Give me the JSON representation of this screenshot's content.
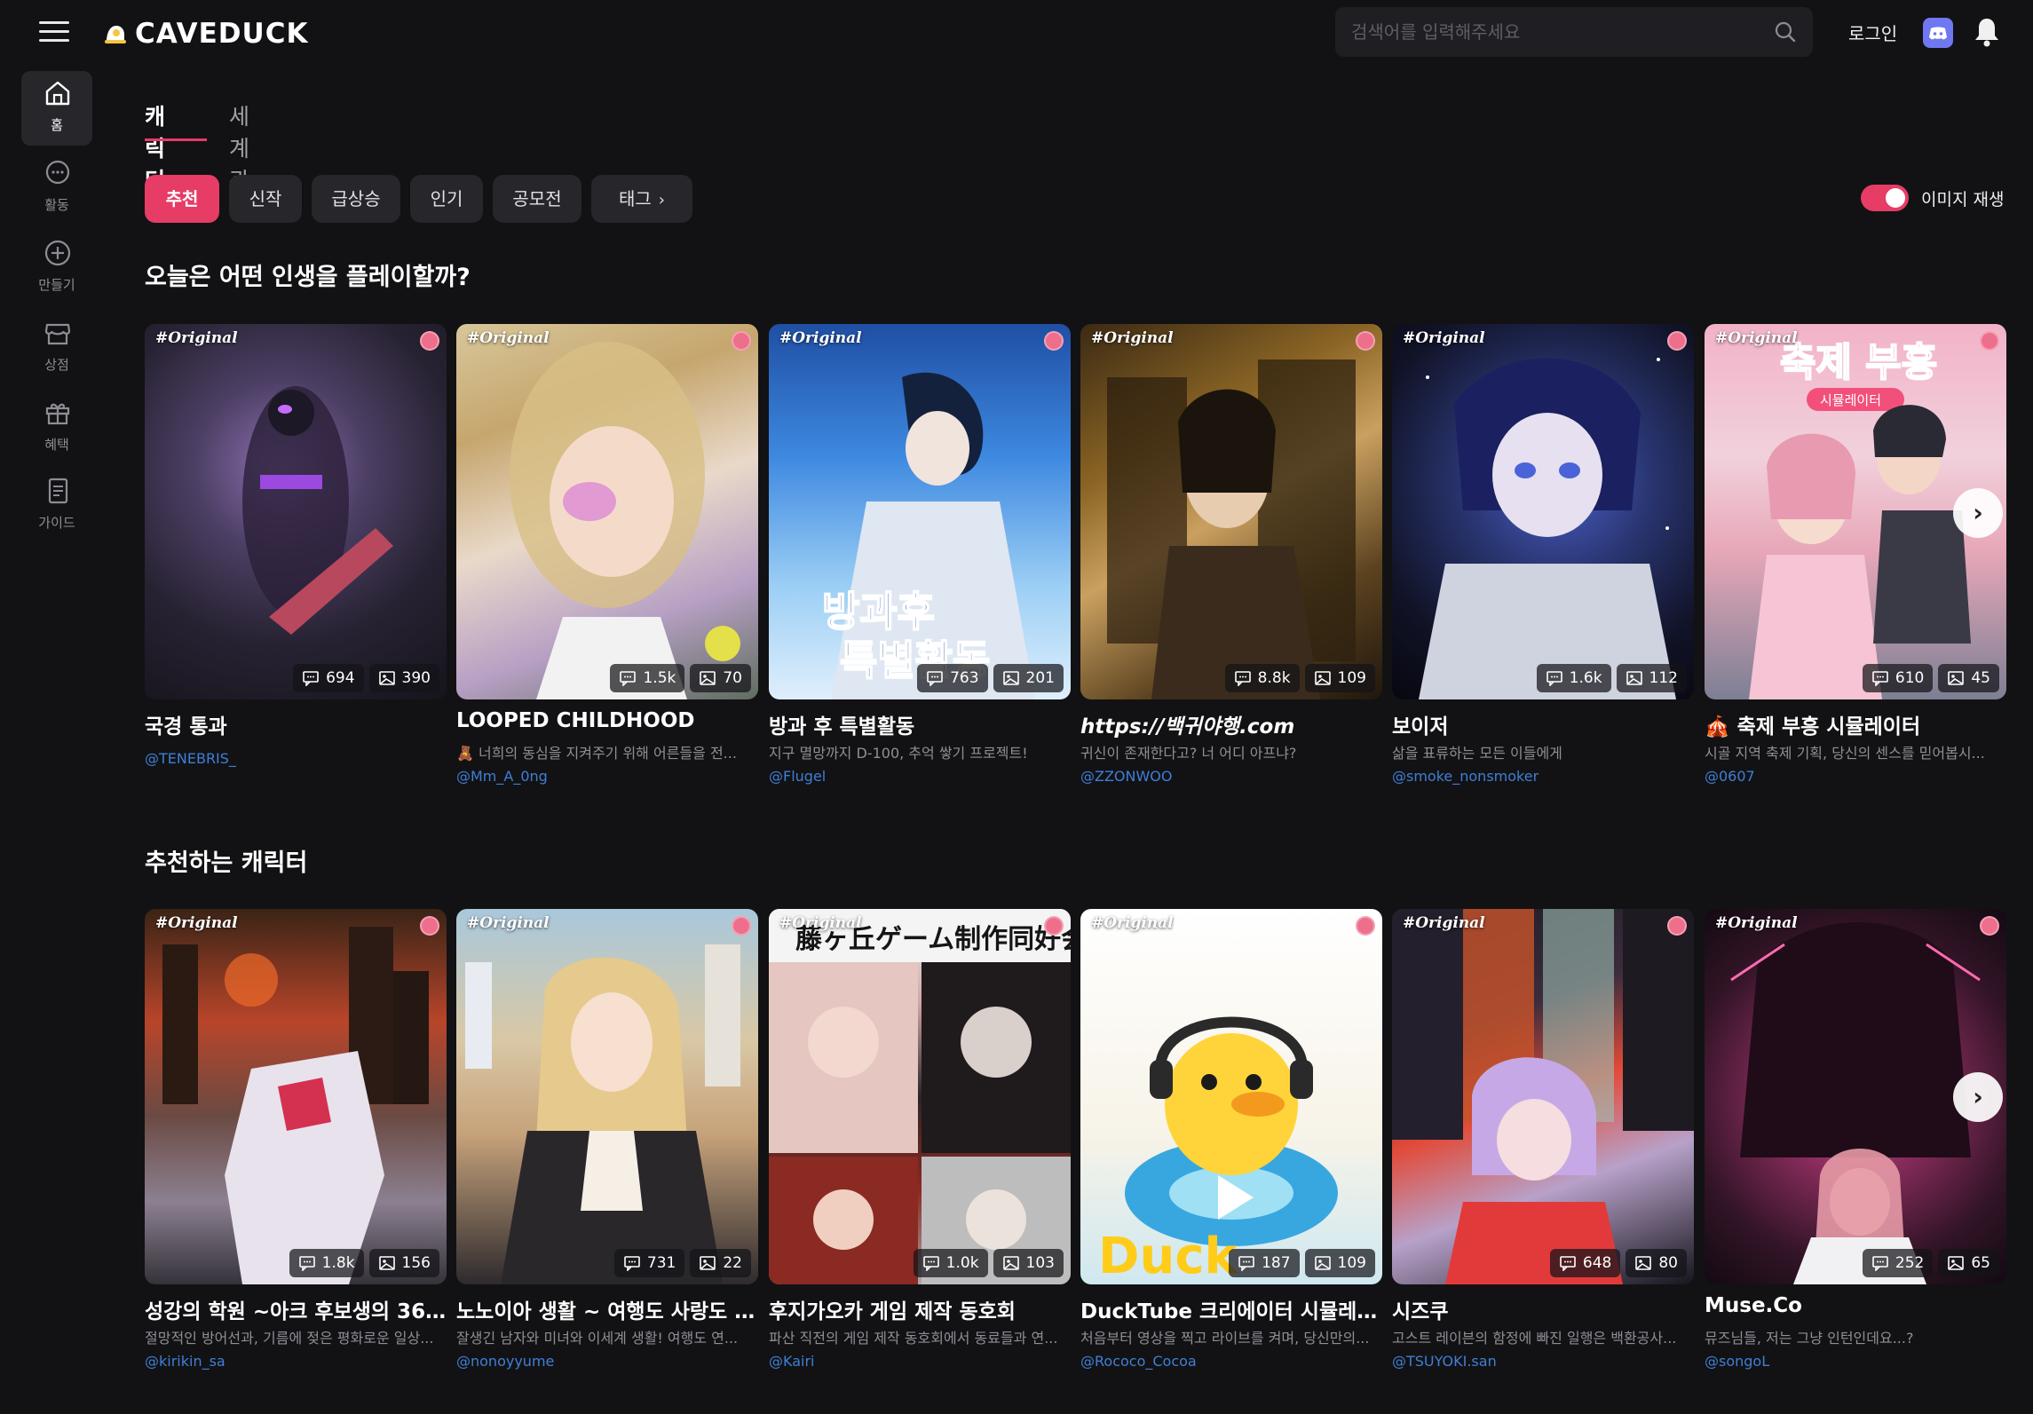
{
  "header": {
    "logo_text": "CAVEDUCK",
    "search_placeholder": "검색어를 입력해주세요",
    "login_label": "로그인"
  },
  "sidebar": {
    "items": [
      {
        "label": "홈",
        "icon": "home-icon",
        "active": true
      },
      {
        "label": "활동",
        "icon": "chat-bubble-icon",
        "active": false
      },
      {
        "label": "만들기",
        "icon": "plus-circle-icon",
        "active": false
      },
      {
        "label": "상점",
        "icon": "store-icon",
        "active": false
      },
      {
        "label": "혜택",
        "icon": "gift-icon",
        "active": false
      },
      {
        "label": "가이드",
        "icon": "document-icon",
        "active": false
      }
    ]
  },
  "tabs": [
    {
      "label": "캐릭터",
      "active": true
    },
    {
      "label": "세계관",
      "active": false
    }
  ],
  "chips": [
    {
      "label": "추천",
      "active": true
    },
    {
      "label": "신작",
      "active": false
    },
    {
      "label": "급상승",
      "active": false
    },
    {
      "label": "인기",
      "active": false
    },
    {
      "label": "공모전",
      "active": false
    },
    {
      "label": "태그",
      "active": false
    }
  ],
  "image_play": {
    "label": "이미지 재생",
    "on": true
  },
  "sections": [
    {
      "title": "오늘은 어떤 인생을 플레이할까?",
      "cards": [
        {
          "tag": "#Original",
          "chats": "694",
          "images": "390",
          "title": "국경 통과",
          "desc": "",
          "author": "@TENEBRIS_"
        },
        {
          "tag": "#Original",
          "chats": "1.5k",
          "images": "70",
          "title": "LOOPED CHILDHOOD",
          "desc": "🧸 너희의 동심을 지켜주기 위해 어른들을 전...",
          "author": "@Mm_A_0ng"
        },
        {
          "tag": "#Original",
          "chats": "763",
          "images": "201",
          "title": "방과 후 특별활동",
          "desc": "지구 멸망까지 D-100, 추억 쌓기 프로젝트!",
          "author": "@Flugel"
        },
        {
          "tag": "#Original",
          "chats": "8.8k",
          "images": "109",
          "title": "https://백귀야행.com",
          "desc": "귀신이 존재한다고? 너 어디 아프냐?",
          "author": "@ZZONWOO"
        },
        {
          "tag": "#Original",
          "chats": "1.6k",
          "images": "112",
          "title": "보이저",
          "desc": "삶을 표류하는 모든 이들에게",
          "author": "@smoke_nonsmoker"
        },
        {
          "tag": "#Original",
          "chats": "610",
          "images": "45",
          "title": "🎪 축제 부흥 시뮬레이터",
          "desc": "시골 지역 축제 기획, 당신의 센스를 믿어봅시...",
          "author": "@0607"
        }
      ]
    },
    {
      "title": "추천하는 캐릭터",
      "cards": [
        {
          "tag": "#Original",
          "chats": "1.8k",
          "images": "156",
          "title": "성강의 학원 ~아크 후보생의 365...",
          "desc": "절망적인 방어선과, 기름에 젖은 평화로운 일상...",
          "author": "@kirikin_sa"
        },
        {
          "tag": "#Original",
          "chats": "731",
          "images": "22",
          "title": "노노이아 생활 ~ 여행도 사랑도 일...",
          "desc": "잘생긴 남자와 미녀와 이세계 생활! 여행도 연...",
          "author": "@nonoyyume"
        },
        {
          "tag": "#Original",
          "chats": "1.0k",
          "images": "103",
          "title": "후지가오카 게임 제작 동호회",
          "desc": "파산 직전의 게임 제작 동호회에서 동료들과 연...",
          "author": "@Kairi"
        },
        {
          "tag": "#Original",
          "chats": "187",
          "images": "109",
          "title": "DuckTube 크리에이터 시뮬레이터",
          "desc": "처음부터 영상을 찍고 라이브를 켜며, 당신만의...",
          "author": "@Rococo_Cocoa"
        },
        {
          "tag": "#Original",
          "chats": "648",
          "images": "80",
          "title": "시즈쿠",
          "desc": "고스트 레이븐의 함정에 빠진 일행은 백환공사...",
          "author": "@TSUYOKI.san"
        },
        {
          "tag": "#Original",
          "chats": "252",
          "images": "65",
          "title": "Muse.Co",
          "desc": "뮤즈님들, 저는 그냥 인턴인데요...?",
          "author": "@songoL"
        }
      ]
    }
  ],
  "thumb_text": {
    "card3_overlay": "방과후\n특별활동",
    "card6_overlay": "축제 부흥",
    "card6_sub": "시뮬레이터",
    "b3_overlay": "藤ヶ丘ゲーム制作同好会",
    "b4_overlay": "Duck"
  },
  "colors": {
    "accent": "#e63c66",
    "background": "#121214",
    "author_link": "#3f7fd6",
    "discord": "#6f78f0"
  }
}
